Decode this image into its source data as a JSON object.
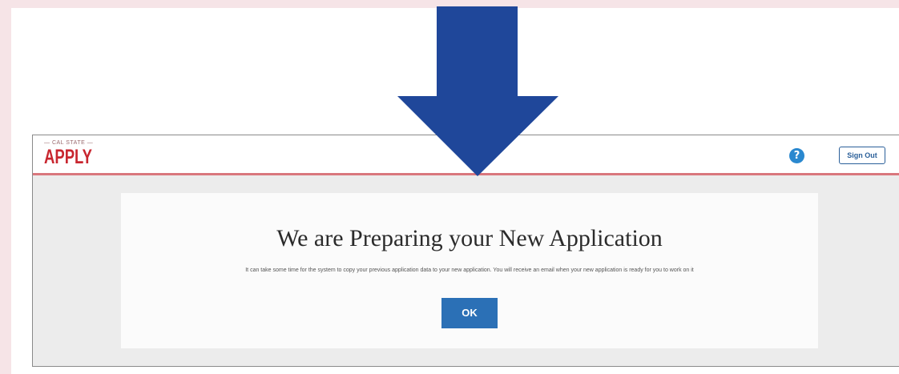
{
  "brand": {
    "logo_subtitle": "— CAL STATE —",
    "logo_title": "APPLY"
  },
  "header": {
    "help_icon": "question-circle-icon",
    "help_glyph": "?",
    "sign_out_label": "Sign Out"
  },
  "dialog": {
    "title": "We are Preparing your New Application",
    "message": "It can take some time for the system to copy your previous application data to your new application. You will receive an email when your new application is ready for you to work on it",
    "ok_label": "OK"
  },
  "annotation": {
    "arrow_icon": "down-arrow-icon"
  },
  "colors": {
    "backdrop": "#f6e4e7",
    "arrow": "#1f479a",
    "brand_red": "#c8262f",
    "header_rule": "#d9777d",
    "help_blue": "#2a88cf",
    "button_blue": "#2b70b6"
  }
}
